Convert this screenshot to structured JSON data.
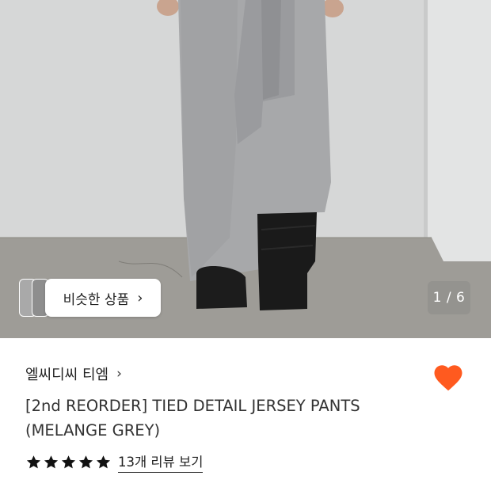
{
  "gallery": {
    "similar_label": "비슷한 상품",
    "counter": "1 / 6",
    "current_index": 1,
    "total": 6
  },
  "product": {
    "brand": "엘씨디씨 티엠",
    "title_line1": "[2nd REORDER] TIED DETAIL JERSEY PANTS",
    "title_line2": "(MELANGE GREY)",
    "liked": true,
    "rating_stars": 5,
    "review_link": "13개 리뷰 보기"
  },
  "colors": {
    "heart": "#ff5a1f",
    "star": "#111111"
  }
}
